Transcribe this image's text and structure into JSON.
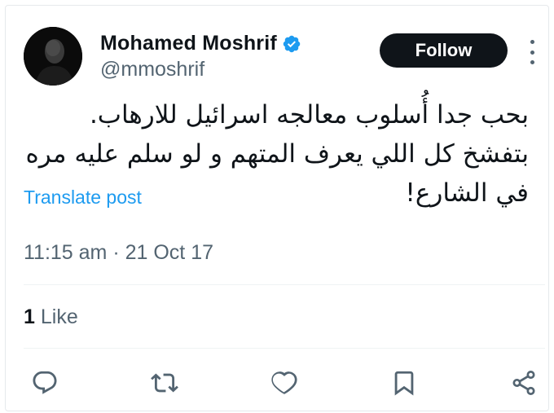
{
  "author": {
    "display_name": "Mohamed Moshrif",
    "handle": "@mmoshrif",
    "verified_color": "#1d9bf0"
  },
  "header": {
    "follow_label": "Follow"
  },
  "tweet": {
    "text": "بحب جدا أُسلوب معالجه اسرائيل للارهاب. بتفشخ كل اللي يعرف المتهم و لو سلم عليه مره في الشارع!",
    "translate_label": "Translate post",
    "timestamp": "11:15 am · 21 Oct 17"
  },
  "engagement": {
    "likes_count": "1",
    "likes_label": "Like"
  },
  "actions": [
    {
      "name": "reply",
      "icon": "reply-icon"
    },
    {
      "name": "repost",
      "icon": "repost-icon"
    },
    {
      "name": "like",
      "icon": "like-icon"
    },
    {
      "name": "bookmark",
      "icon": "bookmark-icon"
    },
    {
      "name": "share",
      "icon": "share-icon"
    }
  ],
  "colors": {
    "text": "#0f1419",
    "secondary": "#536471",
    "link": "#1d9bf0",
    "button_bg": "#0f1419"
  }
}
